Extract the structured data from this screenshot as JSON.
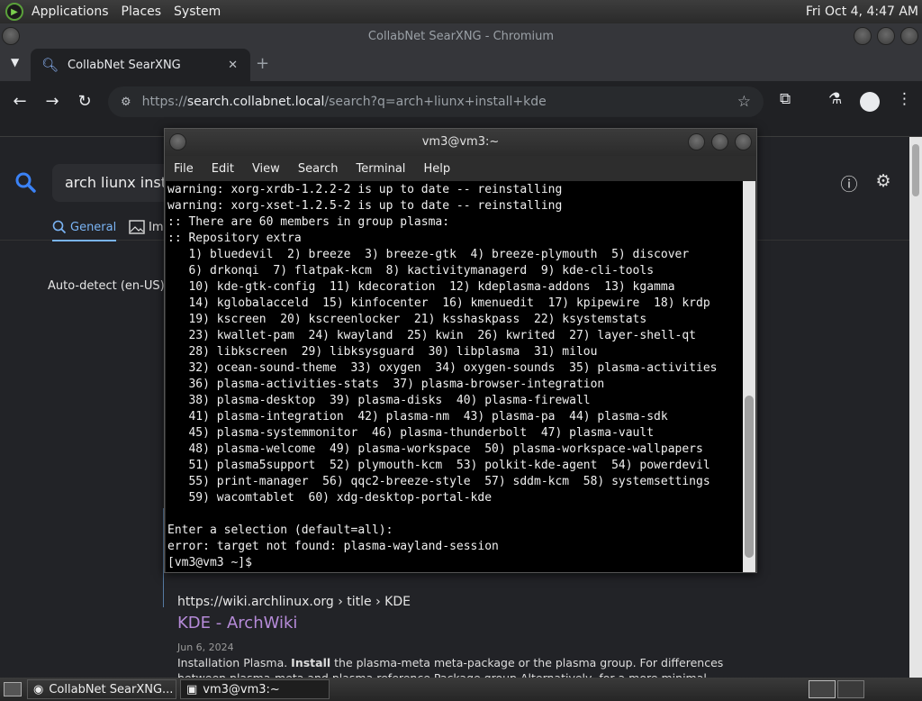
{
  "top_panel": {
    "menus": [
      "Applications",
      "Places",
      "System"
    ],
    "clock": "Fri Oct  4,  4:47 AM"
  },
  "browser": {
    "window_title": "CollabNet SearXNG - Chromium",
    "tab_title": "CollabNet SearXNG",
    "url_prefix": "https://",
    "url_host": "search.collabnet.local",
    "url_path": "/search?q=arch+liunx+install+kde"
  },
  "page": {
    "search_query": "arch liunx instal",
    "categories": [
      "General",
      "Ima"
    ],
    "language": "Auto-detect (en-US)",
    "result": {
      "url": "https://wiki.archlinux.org › title › KDE",
      "title": "KDE - ArchWiki",
      "date": "Jun 6, 2024",
      "snippet_pre": "Installation Plasma. ",
      "snippet_bold": "Install",
      "snippet_post": " the plasma-meta meta-package or the plasma group. For differences between plasma-meta and plasma reference Package group Alternatively, for a more minimal Plasma installation,"
    }
  },
  "terminal": {
    "title": "vm3@vm3:~",
    "menu": [
      "File",
      "Edit",
      "View",
      "Search",
      "Terminal",
      "Help"
    ],
    "lines": [
      "warning: xorg-xrdb-1.2.2-2 is up to date -- reinstalling",
      "warning: xorg-xset-1.2.5-2 is up to date -- reinstalling",
      ":: There are 60 members in group plasma:",
      ":: Repository extra",
      "   1) bluedevil  2) breeze  3) breeze-gtk  4) breeze-plymouth  5) discover",
      "   6) drkonqi  7) flatpak-kcm  8) kactivitymanagerd  9) kde-cli-tools",
      "   10) kde-gtk-config  11) kdecoration  12) kdeplasma-addons  13) kgamma",
      "   14) kglobalacceld  15) kinfocenter  16) kmenuedit  17) kpipewire  18) krdp",
      "   19) kscreen  20) kscreenlocker  21) ksshaskpass  22) ksystemstats",
      "   23) kwallet-pam  24) kwayland  25) kwin  26) kwrited  27) layer-shell-qt",
      "   28) libkscreen  29) libksysguard  30) libplasma  31) milou",
      "   32) ocean-sound-theme  33) oxygen  34) oxygen-sounds  35) plasma-activities",
      "   36) plasma-activities-stats  37) plasma-browser-integration",
      "   38) plasma-desktop  39) plasma-disks  40) plasma-firewall",
      "   41) plasma-integration  42) plasma-nm  43) plasma-pa  44) plasma-sdk",
      "   45) plasma-systemmonitor  46) plasma-thunderbolt  47) plasma-vault",
      "   48) plasma-welcome  49) plasma-workspace  50) plasma-workspace-wallpapers",
      "   51) plasma5support  52) plymouth-kcm  53) polkit-kde-agent  54) powerdevil",
      "   55) print-manager  56) qqc2-breeze-style  57) sddm-kcm  58) systemsettings",
      "   59) wacomtablet  60) xdg-desktop-portal-kde",
      "",
      "Enter a selection (default=all):",
      "error: target not found: plasma-wayland-session",
      "[vm3@vm3 ~]$ "
    ]
  },
  "taskbar": {
    "items": [
      "CollabNet SearXNG...",
      "vm3@vm3:~"
    ]
  }
}
